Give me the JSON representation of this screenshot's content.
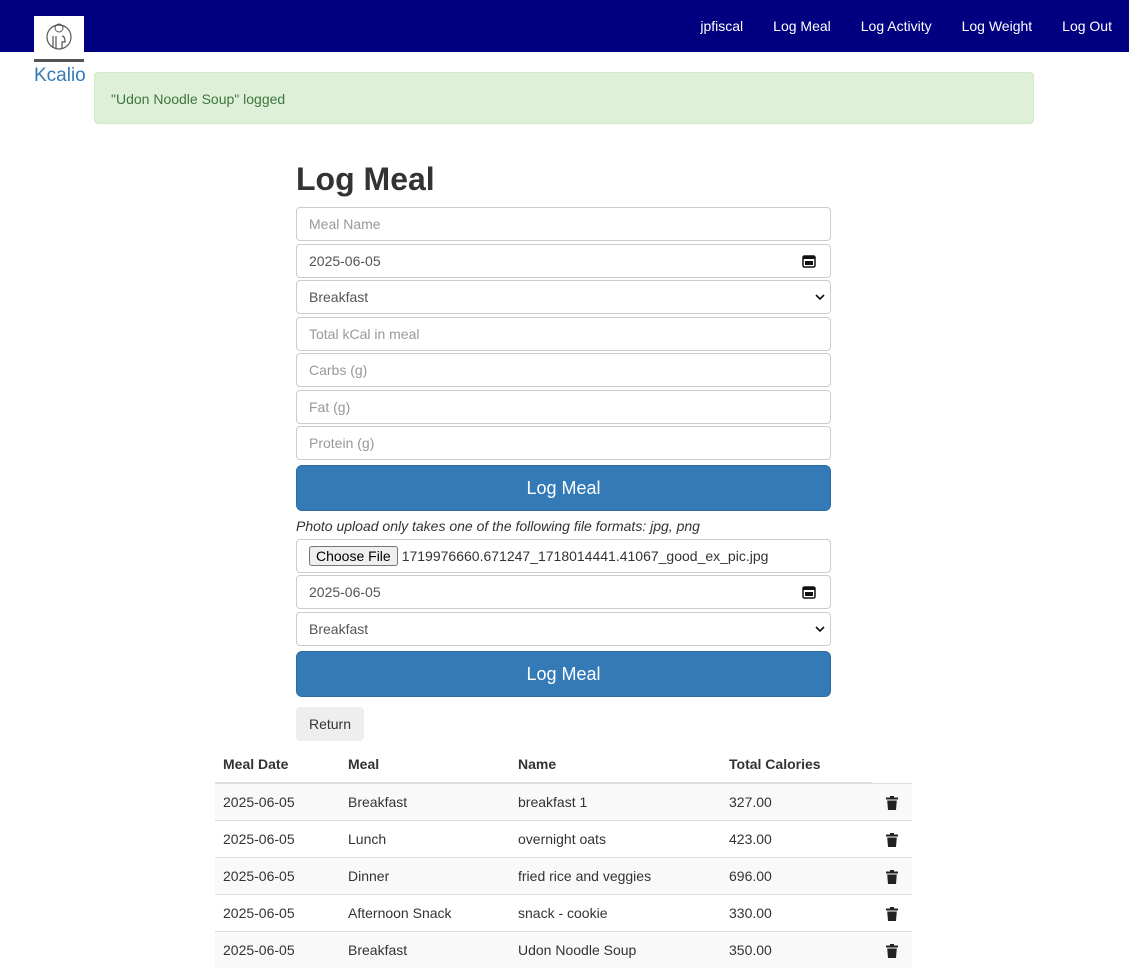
{
  "brand": {
    "name": "Kcalio",
    "logo_text": "Kcal"
  },
  "nav": {
    "items": [
      {
        "label": "jpfiscal"
      },
      {
        "label": "Log Meal"
      },
      {
        "label": "Log Activity"
      },
      {
        "label": "Log Weight"
      },
      {
        "label": "Log Out"
      }
    ],
    "background_color": "#000080"
  },
  "alert": {
    "message": "\"Udon Noodle Soup\" logged",
    "color": "#dff0d8"
  },
  "form": {
    "title": "Log Meal",
    "meal_name_placeholder": "Meal Name",
    "date_value": "2025-06-05",
    "meal_type_value": "Breakfast",
    "kcal_placeholder": "Total kCal in meal",
    "carbs_placeholder": "Carbs (g)",
    "fat_placeholder": "Fat (g)",
    "protein_placeholder": "Protein (g)",
    "submit_label": "Log Meal"
  },
  "photo_form": {
    "note": "Photo upload only takes one of the following file formats: jpg, png",
    "choose_file_label": "Choose File",
    "file_name": "1719976660.671247_1718014441.41067_good_ex_pic.jpg",
    "date_value": "2025-06-05",
    "meal_type_value": "Breakfast",
    "submit_label": "Log Meal"
  },
  "return_label": "Return",
  "table": {
    "headers": [
      "Meal Date",
      "Meal",
      "Name",
      "Total Calories"
    ],
    "rows": [
      {
        "date": "2025-06-05",
        "meal": "Breakfast",
        "name": "breakfast 1",
        "calories": "327.00"
      },
      {
        "date": "2025-06-05",
        "meal": "Lunch",
        "name": "overnight oats",
        "calories": "423.00"
      },
      {
        "date": "2025-06-05",
        "meal": "Dinner",
        "name": "fried rice and veggies",
        "calories": "696.00"
      },
      {
        "date": "2025-06-05",
        "meal": "Afternoon Snack",
        "name": "snack - cookie",
        "calories": "330.00"
      },
      {
        "date": "2025-06-05",
        "meal": "Breakfast",
        "name": "Udon Noodle Soup",
        "calories": "350.00"
      }
    ],
    "delete_icon": "trash-icon"
  },
  "accent_color": "#337ab7"
}
